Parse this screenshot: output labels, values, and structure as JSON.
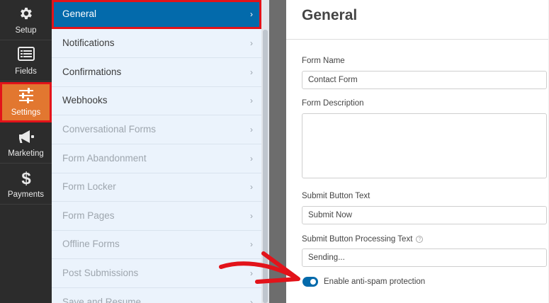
{
  "rail": {
    "items": [
      {
        "label": "Setup",
        "icon": "gear-icon"
      },
      {
        "label": "Fields",
        "icon": "fields-icon"
      },
      {
        "label": "Settings",
        "icon": "sliders-icon"
      },
      {
        "label": "Marketing",
        "icon": "megaphone-icon"
      },
      {
        "label": "Payments",
        "icon": "dollar-icon"
      }
    ],
    "active": "Settings"
  },
  "settings_nav": {
    "items": [
      {
        "label": "General",
        "state": "active"
      },
      {
        "label": "Notifications",
        "state": "enabled"
      },
      {
        "label": "Confirmations",
        "state": "enabled"
      },
      {
        "label": "Webhooks",
        "state": "enabled"
      },
      {
        "label": "Conversational Forms",
        "state": "disabled"
      },
      {
        "label": "Form Abandonment",
        "state": "disabled"
      },
      {
        "label": "Form Locker",
        "state": "disabled"
      },
      {
        "label": "Form Pages",
        "state": "disabled"
      },
      {
        "label": "Offline Forms",
        "state": "disabled"
      },
      {
        "label": "Post Submissions",
        "state": "disabled"
      },
      {
        "label": "Save and Resume",
        "state": "disabled"
      }
    ],
    "chevron": "›"
  },
  "main": {
    "title": "General",
    "form_name_label": "Form Name",
    "form_name_value": "Contact Form",
    "form_description_label": "Form Description",
    "form_description_value": "",
    "submit_text_label": "Submit Button Text",
    "submit_text_value": "Submit Now",
    "processing_text_label": "Submit Button Processing Text",
    "processing_help": "?",
    "processing_text_value": "Sending...",
    "antispam_label": "Enable anti-spam protection",
    "antispam_enabled": true
  },
  "colors": {
    "rail_bg": "#2c2c2c",
    "rail_active": "#e27730",
    "nav_active": "#036aab",
    "highlight_outline": "#e2131a",
    "toggle_on": "#036aab",
    "annotation_arrow": "#e2131a"
  }
}
